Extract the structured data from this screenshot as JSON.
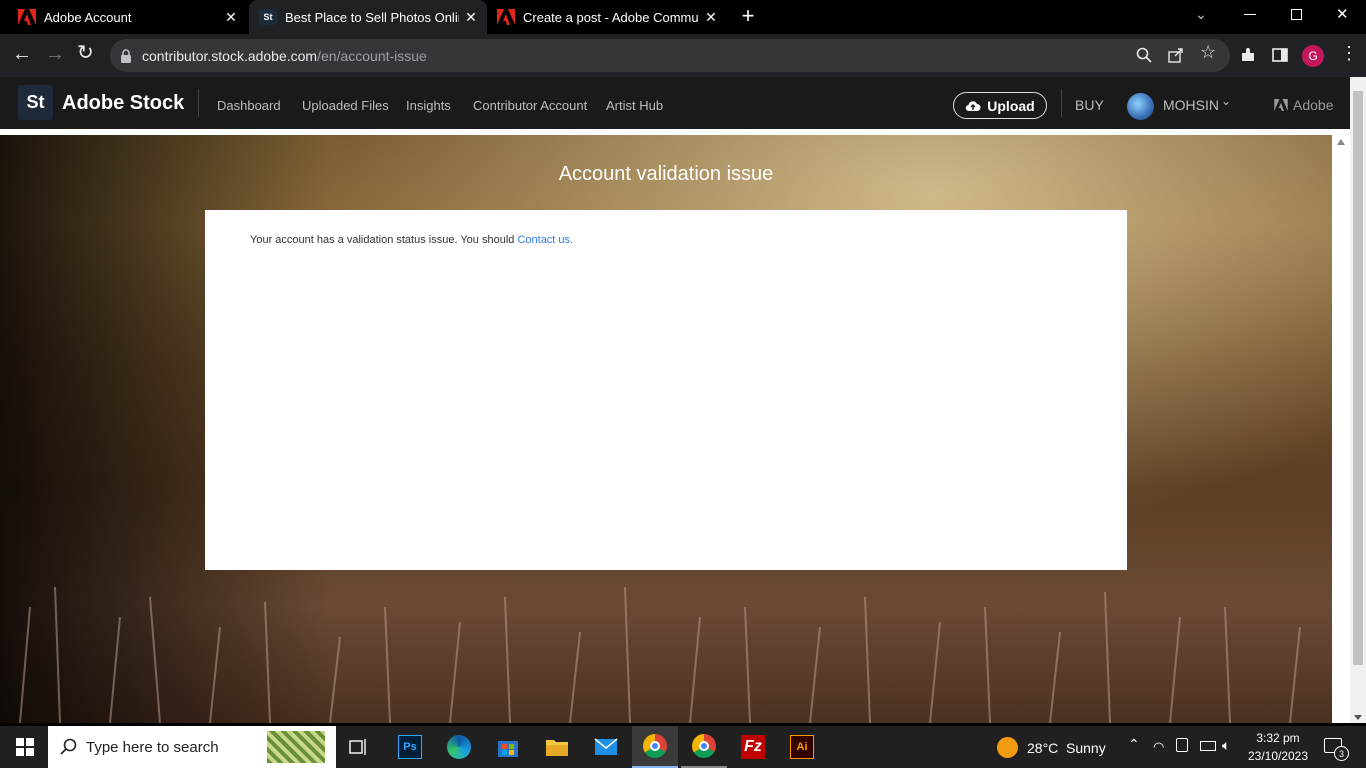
{
  "browser": {
    "tabs": [
      {
        "title": "Adobe Account",
        "active": false
      },
      {
        "title": "Best Place to Sell Photos Online,",
        "active": true
      },
      {
        "title": "Create a post - Adobe Commun",
        "active": false
      }
    ],
    "url_host": "contributor.stock.adobe.com",
    "url_path": "/en/account-issue",
    "profile_initial": "G"
  },
  "site": {
    "logo_mark": "St",
    "logo_text": "Adobe Stock",
    "nav": [
      "Dashboard",
      "Uploaded Files",
      "Insights",
      "Contributor Account",
      "Artist Hub"
    ],
    "upload_label": "Upload",
    "buy_label": "BUY",
    "username": "MOHSIN",
    "adobe_label": "Adobe"
  },
  "page": {
    "title": "Account validation issue",
    "message": "Your account has a validation status issue. You should ",
    "contact_link": "Contact us",
    "period": "."
  },
  "taskbar": {
    "search_placeholder": "Type here to search",
    "weather_temp": "28°C",
    "weather_desc": "Sunny",
    "time": "3:32 pm",
    "date": "23/10/2023",
    "notification_count": "3"
  }
}
